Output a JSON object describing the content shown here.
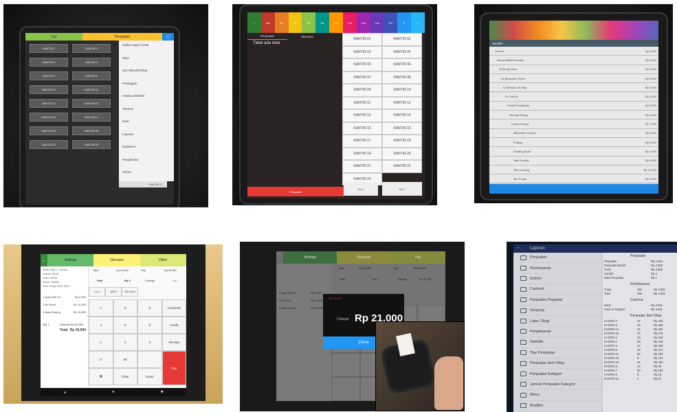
{
  "panel1": {
    "tabs": [
      "Cari",
      "Penjualan"
    ],
    "canteens": [
      "KANTIN 1",
      "KANTIN 2",
      "KANTIN 3",
      "KANTIN 4",
      "KANTIN 5",
      "KANTIN 6",
      "KANTIN 10",
      "KANTIN 11",
      "KANTIN 13",
      "KANTIN 14",
      "KANTIN 16",
      "KANTIN 17",
      "KANTIN 19",
      "KANTIN 20",
      "KANTIN 21",
      "KANTIN 22"
    ],
    "menu": [
      "Daftar Saget Cetak",
      "Meja",
      "Kas Masuk/Keluar",
      "Pelanggan",
      "Analisa Member",
      "Absensi",
      "Nota",
      "Laporan",
      "Database",
      "Pengaturan",
      "Keluar"
    ],
    "popup": "KANTIN 27"
  },
  "panel2": {
    "tabs": [
      "Penjualan",
      "Diproses"
    ],
    "empty": "Tidak ada data",
    "canteens": [
      "KANTIN 01",
      "KANTIN 02",
      "KANTIN 03",
      "KANTIN 04",
      "KANTIN 05",
      "KANTIN 06",
      "KANTIN 07",
      "KANTIN 08",
      "KANTIN 09",
      "KANTIN 10",
      "KANTIN 11",
      "KANTIN 12",
      "KANTIN 13",
      "KANTIN 14",
      "KANTIN 15",
      "KANTIN 16",
      "KANTIN 17",
      "KANTIN 18",
      "KANTIN 19",
      "KANTIN 20",
      "KANTIN 21",
      "KANTIN 22",
      "KANTIN 23"
    ],
    "bottom_left": "Penjualan",
    "bottom_mid": "Rp 0",
    "bottom_right": "Rp 0",
    "colors": [
      "#2e7d32",
      "#c0392b",
      "#e67e22",
      "#f1c40f",
      "#8bc34a",
      "#009688",
      "#ff9800",
      "#e91e63",
      "#9c27b0",
      "#673ab7",
      "#3f51b5",
      "#2196f3",
      "#29b6f6"
    ],
    "top_tabs": [
      "Ba",
      "Do",
      "Pe",
      "Pe",
      "Sa",
      "Da",
      "Cat",
      "Cat",
      "Cat",
      "Pel"
    ]
  },
  "panel3": {
    "header": "Modifier",
    "items": [
      {
        "name": "Cheers",
        "price": "Rp 3.000"
      },
      {
        "name": "Dessert/Milk/Smoothy",
        "price": "Rp 5.000"
      },
      {
        "name": "Es Bengi Susu",
        "price": "Rp 4.000"
      },
      {
        "name": "Es Blewah/Lt Teh/Li",
        "price": "Rp 3.000"
      },
      {
        "name": "Es Blewah Teh Hijo",
        "price": "Rp 3.000"
      },
      {
        "name": "Es Teh/Jer",
        "price": "Rp 2.000"
      },
      {
        "name": "Fanta/Coca/Sprite",
        "price": "Rp 5.000"
      },
      {
        "name": "Goreng Pisang",
        "price": "Rp 4.000"
      },
      {
        "name": "Lecker Keong",
        "price": "Rp 7.000"
      },
      {
        "name": "Milkshake Cokelat",
        "price": "Rp 5.000"
      },
      {
        "name": "Puding",
        "price": "Rp 3.000"
      },
      {
        "name": "Pudding Buah",
        "price": "Rp 4.000"
      },
      {
        "name": "Sate Kerang",
        "price": "Rp 4.000"
      },
      {
        "name": "Tahu Lacang",
        "price": "Rp 10.000"
      },
      {
        "name": "Teh Pucuk",
        "price": "Rp 4.000"
      }
    ]
  },
  "panel4": {
    "tabs": [
      "Settings",
      "Discount",
      "Other"
    ],
    "receipt": [
      "Table: Meja 1 / Guests",
      "Invoice: 00016",
      "Order: 00004",
      "Server: cashier",
      "Time: 18 Apr 2022 19:52"
    ],
    "lines": [
      {
        "name": "1 Aqua 600 ml",
        "price": "Rp 4,000"
      },
      {
        "name": "1 Es Jeruk",
        "price": "Rp 10,000"
      },
      {
        "name": "1 Nasi Goreng",
        "price": "Rp 15,000"
      }
    ],
    "qty": "Qty 3",
    "subtotal": "Subtotal  Rp 29,000",
    "total_label": "Total",
    "total_value": "Rp 29,000",
    "summary": [
      {
        "k": "Total",
        "v": "Rp 29,000"
      },
      {
        "k": "Pay",
        "v": "Rp 29,000"
      }
    ],
    "paid": {
      "k": "Paid",
      "v": "Rp 0",
      "change": "Change",
      "cv": "Rp 0"
    },
    "pay_types": [
      "Cash",
      "QRIS",
      "Gift Card"
    ],
    "keys": [
      "7",
      "8",
      "9",
      "Customer",
      "4",
      "5",
      "6",
      "Credit",
      "1",
      "2",
      "3",
      "Receipt",
      "0",
      "00",
      ".",
      "Pay"
    ],
    "bottom": [
      "Clear",
      "Exact"
    ]
  },
  "panel5": {
    "tabs": [
      "Settings",
      "Discount",
      "Pay"
    ],
    "dialog_change": "Change",
    "dialog_amount": "Rp 21,000",
    "dialog_button": "Close",
    "dialog_top": "Rp 79,000",
    "lines": [
      {
        "name": "1 Aqua 600 ml",
        "price": "Rp 4,000"
      },
      {
        "name": "1 Es Jeruk",
        "price": "Rp 10,000"
      },
      {
        "name": "1 Nasi Goreng",
        "price": "Rp 15,000"
      }
    ],
    "summary": [
      {
        "k": "Total",
        "v": "Rp 29,000"
      },
      {
        "k": "Pay",
        "v": "Rp 29,000"
      }
    ],
    "paid": {
      "k": "Paid",
      "v": "Rp 0",
      "change": "Change",
      "cv": "Rp 21,000"
    }
  },
  "panel6": {
    "title": "Laporan",
    "menu": [
      "Penjualan",
      "Pembayaran",
      "Diskon",
      "Cashout",
      "Penjualan Pegawai",
      "Ganjung",
      "Laba / Rugi",
      "Pengeluaran",
      "Statistik",
      "Tipe Penjualan",
      "Penjualan Item Meja",
      "Penjualan Kategori",
      "Jumlah Penjualan Kategori",
      "Menu",
      "Modifier"
    ],
    "section1": "Penjualan",
    "rows1": [
      [
        "Penjualan",
        "Rp 4.500"
      ],
      [
        "Penjualan Bersih",
        "Rp 4.500"
      ],
      [
        "Tunai",
        "Rp 4.500"
      ],
      [
        "Jumlah",
        "Rp 4"
      ],
      [
        "Rata Penjualan",
        "Rp 1"
      ]
    ],
    "section2": "Pembayaran",
    "rows2": [
      [
        "Tunai",
        "363",
        "Rp 4.551"
      ],
      [
        "Total",
        "363",
        "Rp 4.551"
      ]
    ],
    "section3": "Cashout",
    "rows3": [
      [
        "Setor",
        "Rp 4.551"
      ],
      [
        "Cash in Register",
        "Rp 4.551"
      ]
    ],
    "section4": "Penjualan Item Meja",
    "rows4": [
      [
        "KANTIN 4",
        "37",
        "Rp 438"
      ],
      [
        "KANTIN 5",
        "43",
        "Rp 450"
      ],
      [
        "KANTIN 13",
        "34",
        "Rp 404"
      ],
      [
        "KANTIN 15",
        "22",
        "Rp 175"
      ],
      [
        "KANTIN 2",
        "25",
        "Rp 440"
      ],
      [
        "KANTIN 1",
        "30",
        "Rp 418"
      ],
      [
        "KANTIN 3",
        "27",
        "Rp 308"
      ],
      [
        "KANTIN 6",
        "33",
        "Rp 217"
      ],
      [
        "KANTIN 11",
        "22",
        "Rp 299"
      ],
      [
        "KANTIN 12",
        "9",
        "Rp 107"
      ],
      [
        "KANTIN 14",
        "21",
        "Rp 156"
      ],
      [
        "KANTIN 8",
        "14",
        "Rp 80"
      ],
      [
        "KANTIN 7",
        "19",
        "Rp 163"
      ],
      [
        "KANTIN 9",
        "6",
        "Rp 45"
      ],
      [
        "KANTIN 10",
        "5",
        "Rp 37"
      ]
    ]
  }
}
